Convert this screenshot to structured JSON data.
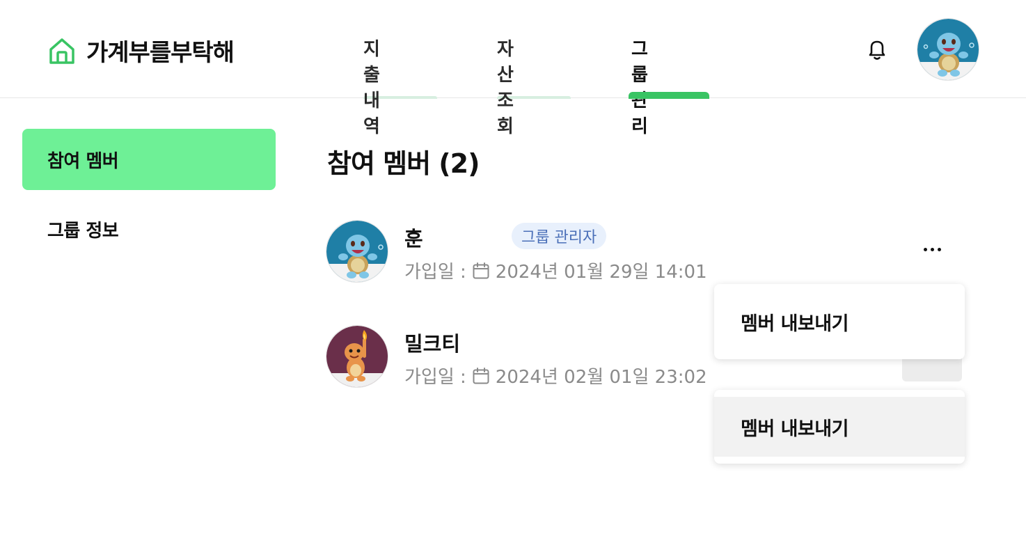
{
  "header": {
    "app_title": "가계부를부탁해",
    "tabs": [
      {
        "label": "지출 내역"
      },
      {
        "label": "자산 조회"
      },
      {
        "label": "그룹 관리"
      }
    ],
    "active_tab": "그룹 관리"
  },
  "sidebar": {
    "items": [
      {
        "label": "참여 멤버"
      },
      {
        "label": "그룹 정보"
      }
    ]
  },
  "main": {
    "title": "참여 멤버 (2)",
    "members": [
      {
        "name": "훈",
        "badge": "그룹 관리자",
        "joined_label": "가입일 :",
        "joined_value": "2024년 01월 29일 14:01"
      },
      {
        "name": "밀크티",
        "joined_label": "가입일 :",
        "joined_value": "2024년 02월 01일 23:02"
      }
    ]
  },
  "menus": [
    {
      "item_label": "멤버 내보내기"
    },
    {
      "item_label": "멤버 내보내기"
    }
  ],
  "colors": {
    "accent_green": "#39c463",
    "sidebar_active": "#6ef096",
    "badge_bg": "#e8f0fc",
    "badge_text": "#4a6fb8"
  }
}
